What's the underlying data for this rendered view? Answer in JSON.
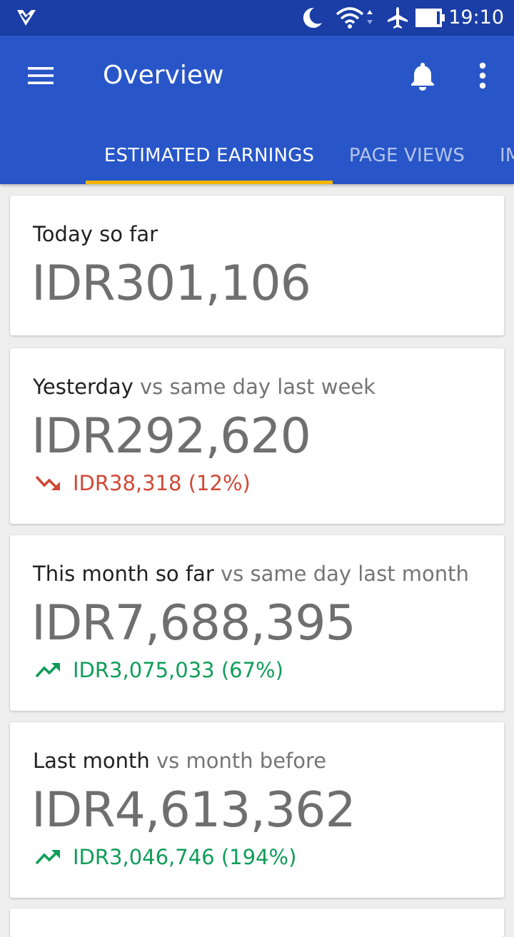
{
  "status_bar": {
    "time": "19:10",
    "icons": [
      "app-logo-icon",
      "moon-icon",
      "wifi-icon",
      "airplane-icon",
      "battery-icon"
    ]
  },
  "app_bar": {
    "title": "Overview",
    "icons": [
      "menu-icon",
      "bell-icon",
      "more-vert-icon"
    ]
  },
  "tabs": [
    {
      "label": "ESTIMATED EARNINGS",
      "active": true
    },
    {
      "label": "PAGE VIEWS",
      "active": false
    },
    {
      "label": "IMPRESSIONS",
      "active": false
    }
  ],
  "cards": [
    {
      "label": "Today so far",
      "compare": "",
      "value": "IDR301,106"
    },
    {
      "label": "Yesterday",
      "compare": " vs same day last week",
      "value": "IDR292,620",
      "change": "IDR38,318 (12%)",
      "trend": "down"
    },
    {
      "label": "This month so far",
      "compare": " vs same day last month",
      "value": "IDR7,688,395",
      "change": "IDR3,075,033 (67%)",
      "trend": "up"
    },
    {
      "label": "Last month",
      "compare": " vs month before",
      "value": "IDR4,613,362",
      "change": "IDR3,046,746 (194%)",
      "trend": "up"
    }
  ],
  "colors": {
    "status_bar": "#1a3ea6",
    "app_bar": "#2856c8",
    "tab_indicator": "#f4b400",
    "trend_down": "#d14836",
    "trend_up": "#109d59"
  }
}
